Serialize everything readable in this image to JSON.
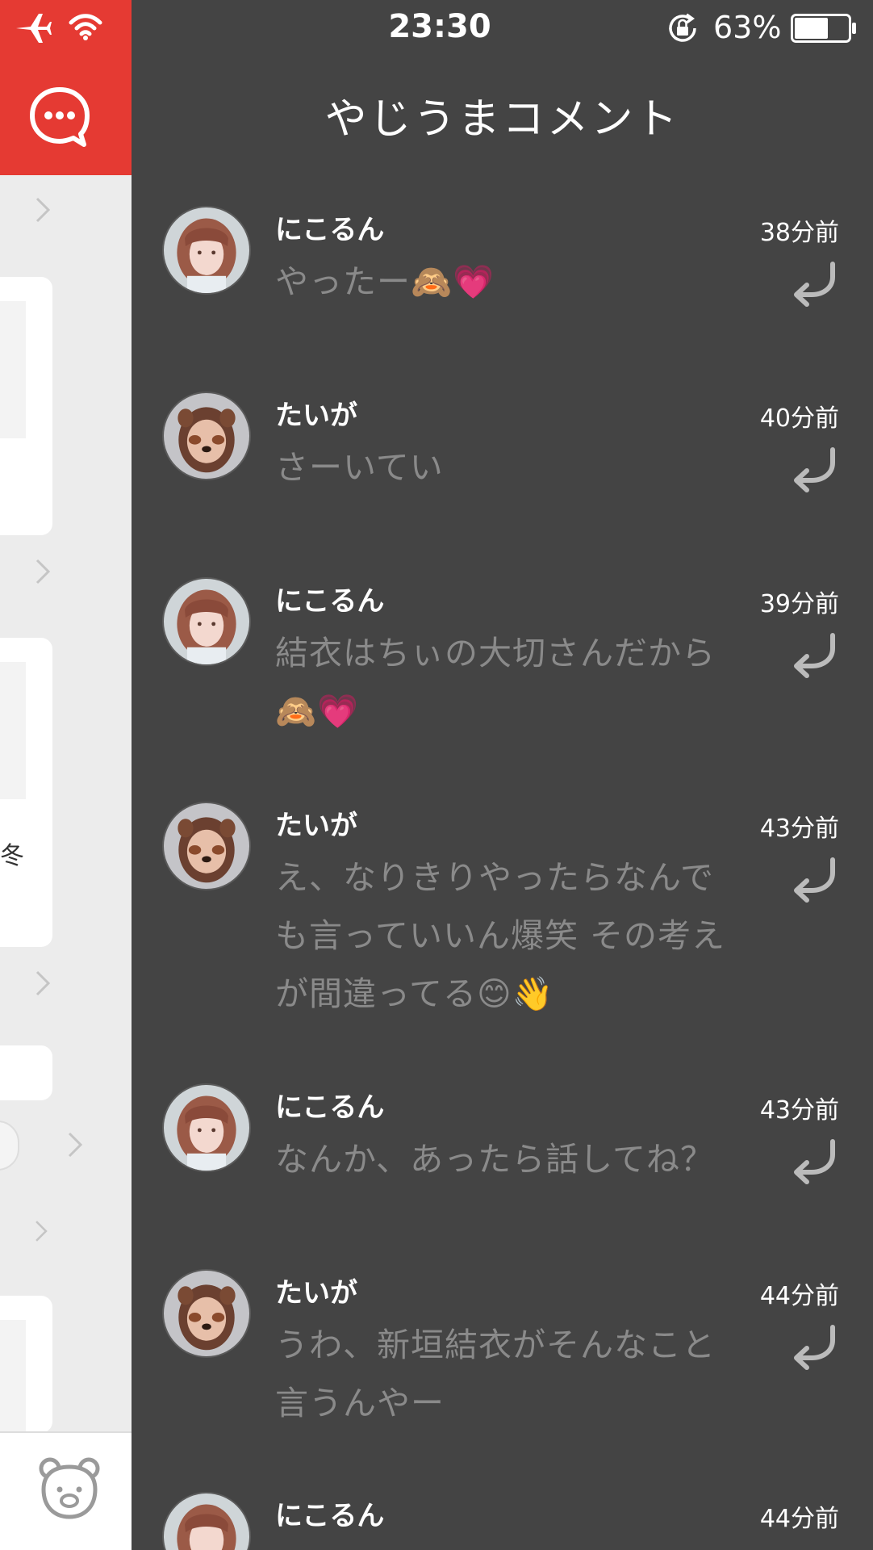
{
  "status_bar": {
    "time": "23:30",
    "battery_percent": "63%",
    "battery_level": 0.63,
    "icons": [
      "airplane-icon",
      "wifi-icon",
      "rotation-lock-icon",
      "battery-icon"
    ]
  },
  "left_panel": {
    "header_icon": "chat-bubble-icon",
    "tab_icon": "bear-icon",
    "partial_text": "冬",
    "accent_color": "#e53a33"
  },
  "header": {
    "title": "やじうまコメント"
  },
  "comments": [
    {
      "user": "にこるん",
      "avatar": "nikorun",
      "time": "38分前",
      "text": "やったー🙈💗"
    },
    {
      "user": "たいが",
      "avatar": "taiga",
      "time": "40分前",
      "text": "さーいてい"
    },
    {
      "user": "にこるん",
      "avatar": "nikorun",
      "time": "39分前",
      "text": "結衣はちぃの大切さんだから🙈💗"
    },
    {
      "user": "たいが",
      "avatar": "taiga",
      "time": "43分前",
      "text": "え、なりきりやったらなんでも言っていいん爆笑 その考えが間違ってる😊👋"
    },
    {
      "user": "にこるん",
      "avatar": "nikorun",
      "time": "43分前",
      "text": "なんか、あったら話してね？"
    },
    {
      "user": "たいが",
      "avatar": "taiga",
      "time": "44分前",
      "text": "うわ、新垣結衣がそんなこと言うんやー"
    },
    {
      "user": "にこるん",
      "avatar": "nikorun",
      "time": "44分前",
      "text": ""
    }
  ],
  "colors": {
    "background": "#444444",
    "username": "#ffffff",
    "comment_text": "#8a8a8a",
    "reply_icon": "#bbbbbb"
  }
}
